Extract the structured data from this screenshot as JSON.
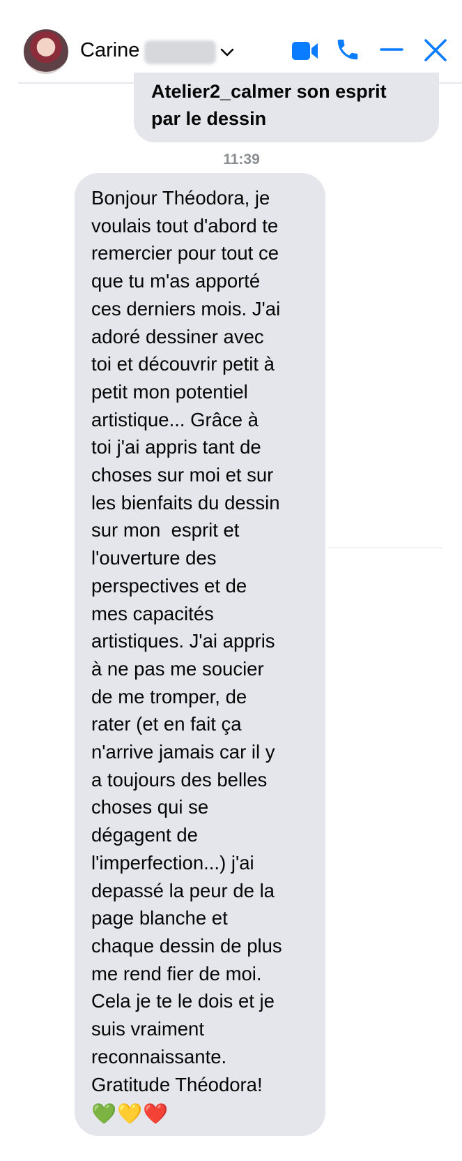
{
  "header": {
    "contact_first_name": "Carine",
    "icons": [
      "video-icon",
      "phone-icon",
      "minimize-icon",
      "close-icon"
    ],
    "accent_color": "#0a7cff"
  },
  "messages": {
    "outgoing_text": "Atelier2_calmer son esprit\npar le dessin",
    "timestamp": "11:39",
    "incoming_text": "Bonjour Théodora, je\nvoulais tout d'abord te\nremercier pour tout ce\nque tu m'as apporté\nces derniers mois. J'ai\nadoré dessiner avec\ntoi et découvrir petit à\npetit mon potentiel\nartistique... Grâce à\ntoi j'ai appris tant de\nchoses sur moi et sur\nles bienfaits du dessin\nsur mon  esprit et\nl'ouverture des\nperspectives et de\nmes capacités\nartistiques. J'ai appris\nà ne pas me soucier\nde me tromper, de\nrater (et en fait ça\nn'arrive jamais car il y\na toujours des belles\nchoses qui se\ndégagent de\nl'imperfection...) j'ai\ndepassé la peur de la\npage blanche et\nchaque dessin de plus\nme rend fier de moi.\nCela je te le dois et je\nsuis vraiment\nreconnaissante.\nGratitude Théodora!",
    "incoming_emoji": "💚💛❤️",
    "bubble_color": "#e4e6eb"
  }
}
